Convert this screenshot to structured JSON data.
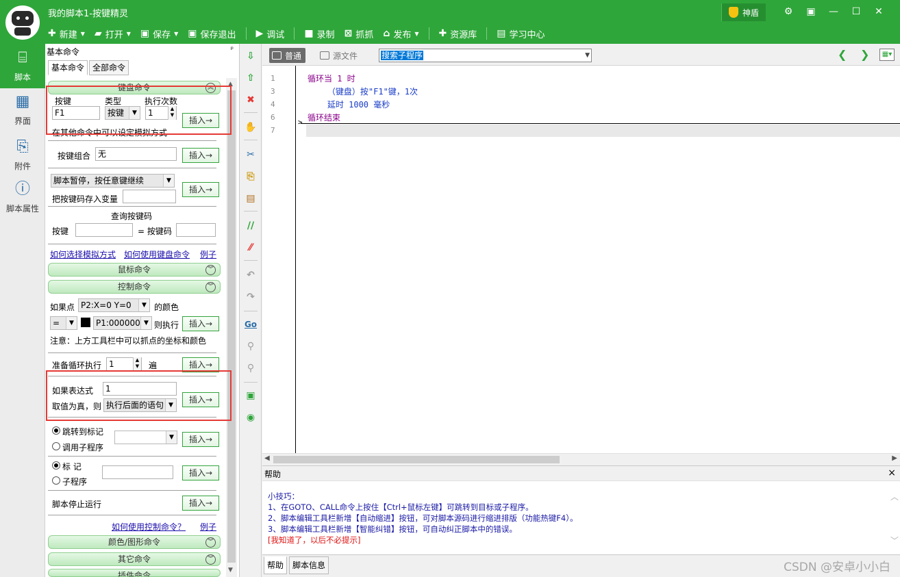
{
  "window": {
    "title": "我的脚本1-按键精灵",
    "shield_label": "神盾"
  },
  "toolbar": {
    "new": "新建",
    "open": "打开",
    "save": "保存",
    "save_exit": "保存退出",
    "debug": "调试",
    "record": "录制",
    "capture": "抓抓",
    "publish": "发布",
    "resources": "资源库",
    "learn": "学习中心"
  },
  "leftnav": {
    "items": [
      {
        "label": "脚本",
        "icon": "script-icon",
        "active": true
      },
      {
        "label": "界面",
        "icon": "layout-icon",
        "active": false
      },
      {
        "label": "附件",
        "icon": "attachment-icon",
        "active": false
      },
      {
        "label": "脚本属性",
        "icon": "info-icon",
        "active": false
      }
    ]
  },
  "panel": {
    "title": "基本命令",
    "pin": "ㅁ",
    "tabs": [
      "基本命令",
      "全部命令"
    ],
    "keyboard": {
      "header": "键盘命令",
      "col_key": "按键",
      "col_type": "类型",
      "col_times": "执行次数",
      "key_value": "F1",
      "type_value": "按键",
      "times_value": "1",
      "insert": "插入→",
      "hint": "在其他命令中可以设定模拟方式",
      "combo_label": "按键组合",
      "combo_value": "无",
      "insert2": "插入→",
      "pause_select": "脚本暂停，按任意键继续",
      "store_label": "把按键码存入变量",
      "insert3": "插入→",
      "query_title": "查询按键码",
      "query_key_label": "按键",
      "query_code_label": "= 按键码",
      "link_mode": "如何选择模拟方式",
      "link_use": "如何使用键盘命令",
      "link_example": "例子"
    },
    "mouse_header": "鼠标命令",
    "control": {
      "header": "控制命令",
      "if_point_label": "如果点",
      "point_select": "P2:X=0 Y=0",
      "color_of": "的颜色",
      "op_select": "=",
      "color_select": "P1:000000",
      "then_exec": "则执行",
      "insert": "插入→",
      "note": "注意：上方工具栏中可以抓点的坐标和颜色",
      "loop_label": "准备循环执行",
      "loop_value": "1",
      "loop_unit": "遍",
      "insert2": "插入→",
      "if_expr_label": "如果表达式",
      "if_expr_value": "1",
      "true_label": "取值为真，则",
      "true_select": "执行后面的语句",
      "insert3": "插入→",
      "goto_label": "跳转到标记",
      "call_label": "调用子程序",
      "insert4": "插入→",
      "mark_label": "标 记",
      "sub_label": "子程序",
      "insert5": "插入→",
      "stop_label": "脚本停止运行",
      "insert6": "插入→",
      "link_use": "如何使用控制命令？",
      "link_example": "例子"
    },
    "color_header": "颜色/图形命令",
    "other_header": "其它命令",
    "plugin_header": "插件命令"
  },
  "editor": {
    "mode_normal": "普通",
    "mode_source": "源文件",
    "sub_search": "搜索子程序",
    "lines": [
      {
        "num": "1",
        "text": "循环当 1 时",
        "kind": "kw"
      },
      {
        "num": "3",
        "text": "    （键盘）按\"F1\"键，1次",
        "kind": "stmt"
      },
      {
        "num": "4",
        "text": "    延时 1000 毫秒",
        "kind": "stmt"
      },
      {
        "num": "6",
        "text": "循环结束",
        "kind": "kw"
      },
      {
        "num": "7",
        "text": "",
        "kind": "stmt"
      }
    ]
  },
  "help": {
    "title": "帮助",
    "close": "×",
    "lines": [
      {
        "text": "小技巧：",
        "color": "#1a1aa6"
      },
      {
        "text": "1、在GOTO、CALL命令上按住【Ctrl+鼠标左键】可跳转到目标或子程序。",
        "color": "#1a1aa6"
      },
      {
        "text": "2、脚本编辑工具栏新增【自动缩进】按钮，可对脚本源码进行缩进排版（功能热键F4）。",
        "color": "#1a1aa6"
      },
      {
        "text": "3、脚本编辑工具栏新增【智能纠错】按钮，可自动纠正脚本中的错误。",
        "color": "#1a1aa6"
      },
      {
        "text": "[我知道了，以后不必提示]",
        "color": "#e01010"
      }
    ],
    "tabs": [
      "帮助",
      "脚本信息"
    ]
  },
  "watermark": "CSDN @安卓小小白",
  "colors": {
    "brand_green": "#2fa63a",
    "highlight_red": "#e53935",
    "link_blue": "#1a0dab"
  }
}
